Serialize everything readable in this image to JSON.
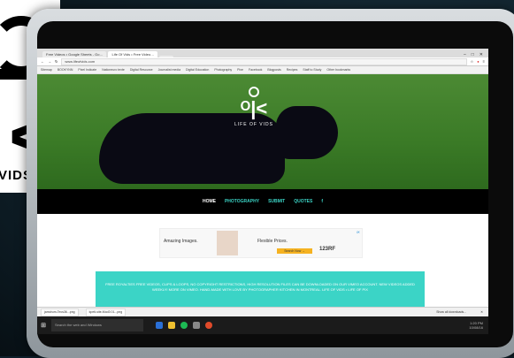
{
  "logo_card": {
    "text": "VIDS",
    "glyph": "<"
  },
  "browser": {
    "tabs": [
      {
        "label": "Free Videos • Google Sheets - Go…",
        "active": false
      },
      {
        "label": "Life Of Vids • Free Video…",
        "active": true
      },
      {
        "label": "",
        "active": false
      }
    ],
    "window_controls": [
      "–",
      "□",
      "✕"
    ],
    "url": "www.lifeofvids.com",
    "bookmarks": [
      "Sitemap",
      "BOOKYNN",
      "Pixel Indicate",
      "Nationeuro texte",
      "Digital Resource",
      "Journalist media",
      "Digital Education",
      "Photography",
      "Pixe",
      "Facebook",
      "Blogposts",
      "Recipes",
      "Staff to Study",
      "Other bookmarks"
    ]
  },
  "site": {
    "logo_mark": "ᴼ|<",
    "name": "LIFE OF VIDS",
    "nav": {
      "home": "HOME",
      "items": [
        "PHOTOGRAPHY",
        "SUBMIT",
        "QUOTES",
        "f"
      ]
    },
    "ad": {
      "text1": "Amazing Images.",
      "text2": "Flexible Prices.",
      "button": "Search Now →",
      "brand": "123RF",
      "corner": "i✕"
    },
    "notice": "FREE ROYALTIES FREE VIDEOS, CLIPS & LOOPS, NO COPYRIGHT RESTRICTIONS, HIGH RESOLUTION FILES CAN BE DOWNLOADED ON OUR VIMEO ACCOUNT. NEW VIDEOS ADDED WEEKLY! MORE ON VIMEO. HAND-MADE WITH LOVE BY PHOTOGRAPHER KITCHEN IN MONTREAL. LIFE OF VIDS • LIFE OF PIX"
  },
  "downloads": {
    "items": [
      "jamdrum-Tecs36...png",
      "kpelt-site-Mod3 01...png"
    ],
    "show_all": "Show all downloads...",
    "close": "✕"
  },
  "taskbar": {
    "start": "⊞",
    "search": "Search the web and Windows",
    "time": "1:20 PM",
    "date": "10/08/16"
  },
  "colors": {
    "accent": "#3bd4c6",
    "nav_bg": "#000000",
    "grass": "#3a7a26"
  }
}
